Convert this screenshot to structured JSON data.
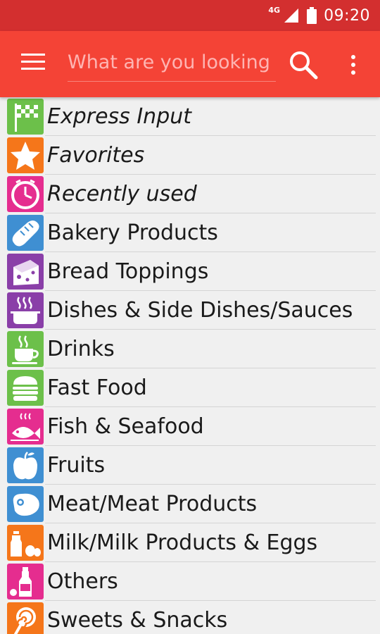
{
  "status_bar": {
    "network": "4G",
    "time": "09:20"
  },
  "toolbar": {
    "search_placeholder": "What are you looking for?"
  },
  "categories": [
    {
      "label": "Express Input",
      "italic": true,
      "icon": "flag-icon",
      "color": "#6cc04a"
    },
    {
      "label": "Favorites",
      "italic": true,
      "icon": "star-icon",
      "color": "#f5761a"
    },
    {
      "label": "Recently used",
      "italic": true,
      "icon": "clock-icon",
      "color": "#e52d8f"
    },
    {
      "label": "Bakery Products",
      "italic": false,
      "icon": "bread-icon",
      "color": "#3f8fd2"
    },
    {
      "label": "Bread Toppings",
      "italic": false,
      "icon": "cheese-icon",
      "color": "#8a3fa8"
    },
    {
      "label": "Dishes & Side Dishes/Sauces",
      "italic": false,
      "icon": "pot-icon",
      "color": "#8a3fa8"
    },
    {
      "label": "Drinks",
      "italic": false,
      "icon": "cup-icon",
      "color": "#6cc04a"
    },
    {
      "label": "Fast Food",
      "italic": false,
      "icon": "burger-icon",
      "color": "#6cc04a"
    },
    {
      "label": "Fish & Seafood",
      "italic": false,
      "icon": "fish-icon",
      "color": "#e52d8f"
    },
    {
      "label": "Fruits",
      "italic": false,
      "icon": "apple-icon",
      "color": "#3f8fd2"
    },
    {
      "label": "Meat/Meat Products",
      "italic": false,
      "icon": "steak-icon",
      "color": "#3f8fd2"
    },
    {
      "label": "Milk/Milk Products & Eggs",
      "italic": false,
      "icon": "milk-icon",
      "color": "#f5761a"
    },
    {
      "label": "Others",
      "italic": false,
      "icon": "bottle-icon",
      "color": "#e52d8f"
    },
    {
      "label": "Sweets & Snacks",
      "italic": false,
      "icon": "lollipop-icon",
      "color": "#f5761a"
    }
  ]
}
